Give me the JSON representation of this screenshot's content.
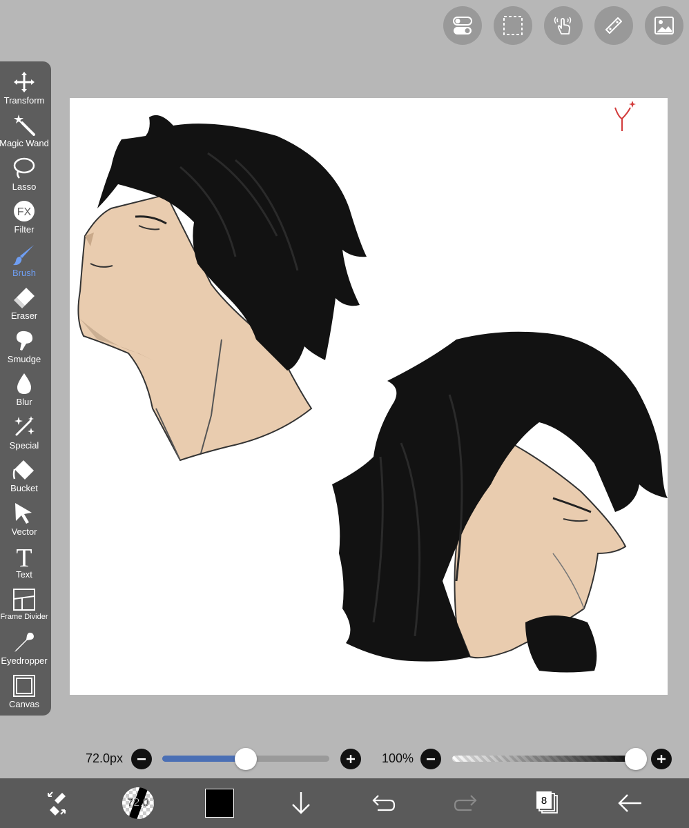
{
  "top_buttons": [
    {
      "icon": "toggle-icon"
    },
    {
      "icon": "selection-icon"
    },
    {
      "icon": "touch-gesture-icon"
    },
    {
      "icon": "ruler-icon"
    },
    {
      "icon": "image-icon"
    }
  ],
  "tools": [
    {
      "label": "Transform",
      "icon": "transform-icon"
    },
    {
      "label": "Magic Wand",
      "icon": "magic-wand-icon"
    },
    {
      "label": "Lasso",
      "icon": "lasso-icon"
    },
    {
      "label": "Filter",
      "icon": "filter-fx-icon"
    },
    {
      "label": "Brush",
      "icon": "brush-icon",
      "active": true
    },
    {
      "label": "Eraser",
      "icon": "eraser-icon"
    },
    {
      "label": "Smudge",
      "icon": "smudge-icon"
    },
    {
      "label": "Blur",
      "icon": "blur-drop-icon"
    },
    {
      "label": "Special",
      "icon": "special-sparkle-icon"
    },
    {
      "label": "Bucket",
      "icon": "bucket-icon"
    },
    {
      "label": "Vector",
      "icon": "vector-cursor-icon"
    },
    {
      "label": "Text",
      "icon": "text-icon"
    },
    {
      "label": "Frame Divider",
      "icon": "frame-divider-icon"
    },
    {
      "label": "Eyedropper",
      "icon": "eyedropper-icon"
    },
    {
      "label": "Canvas",
      "icon": "canvas-icon"
    }
  ],
  "filter_icon_text": "FX",
  "text_icon_glyph": "T",
  "brush_size": {
    "label": "72.0px",
    "value_fraction": 0.5
  },
  "opacity": {
    "label": "100%",
    "value_fraction": 1.0
  },
  "bottom_bar": {
    "brush_preview_label": "72.0",
    "current_color": "#000000",
    "layer_count": "8"
  },
  "colors": {
    "accent": "#6f9ef2",
    "slider_fill": "#4a6fb5",
    "toolbar": "#5d5d5d",
    "background": "#b7b7b7"
  }
}
